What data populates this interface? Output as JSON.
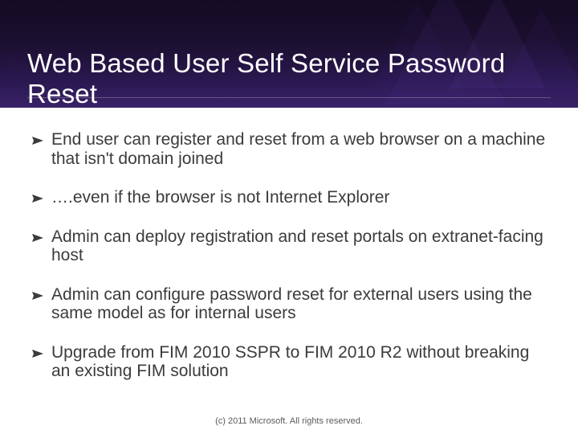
{
  "title": "Web Based User Self Service Password Reset",
  "bullets": [
    "End user can register and reset from a web browser on a machine that isn't domain joined",
    "….even if the browser is not Internet Explorer",
    "Admin can deploy registration and reset portals on extranet-facing host",
    "Admin can configure password reset for external users using the same model as for internal users",
    "Upgrade from FIM 2010 SSPR to FIM 2010 R2 without breaking an existing FIM solution"
  ],
  "footer": "(c) 2011 Microsoft. All rights reserved."
}
